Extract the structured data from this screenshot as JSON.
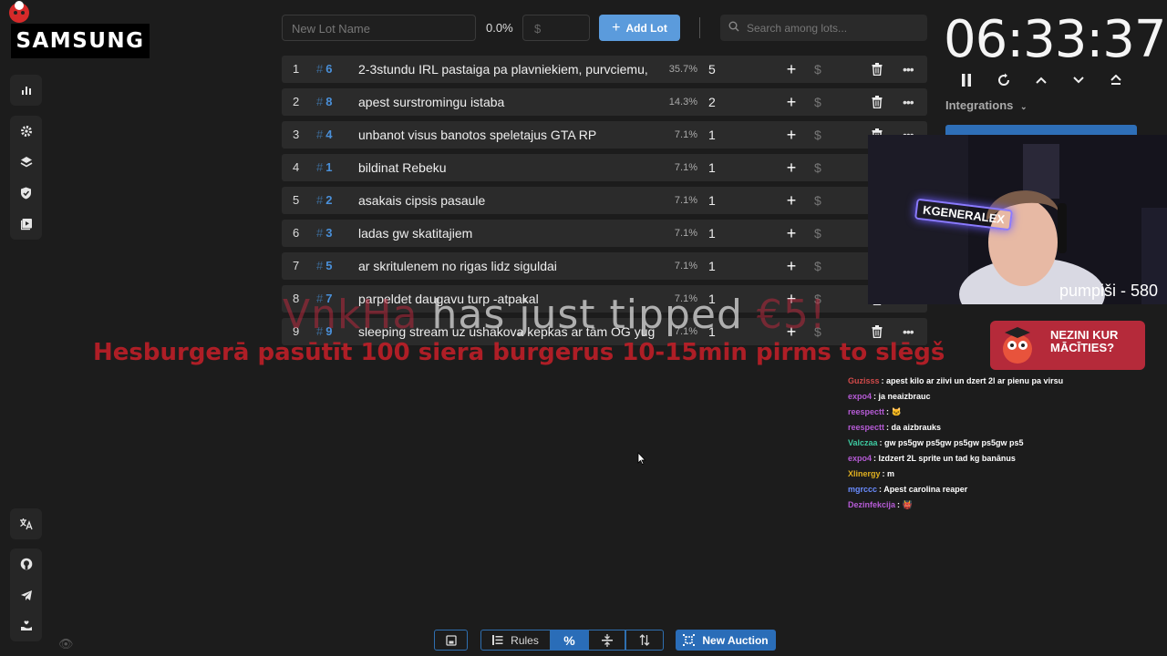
{
  "overlay_brand": "SAMSUNG",
  "topbar": {
    "lot_name_placeholder": "New Lot Name",
    "percent": "0.0%",
    "amount_placeholder": "$",
    "add_lot_label": "Add Lot",
    "search_placeholder": "Search among lots..."
  },
  "lots": [
    {
      "index": "1",
      "id": "6",
      "name": "2-3stundu IRL pastaiga pa plavniekiem, purvciemu,",
      "percent": "35.7%",
      "amount": "5"
    },
    {
      "index": "2",
      "id": "8",
      "name": "apest surstromingu istaba",
      "percent": "14.3%",
      "amount": "2"
    },
    {
      "index": "3",
      "id": "4",
      "name": "unbanot visus banotos speletajus GTA RP",
      "percent": "7.1%",
      "amount": "1"
    },
    {
      "index": "4",
      "id": "1",
      "name": "bildinat Rebeku",
      "percent": "7.1%",
      "amount": "1"
    },
    {
      "index": "5",
      "id": "2",
      "name": "asakais cipsis pasaule",
      "percent": "7.1%",
      "amount": "1"
    },
    {
      "index": "6",
      "id": "3",
      "name": "ladas gw skatitajiem",
      "percent": "7.1%",
      "amount": "1"
    },
    {
      "index": "7",
      "id": "5",
      "name": "ar skritulenem no rigas lidz siguldai",
      "percent": "7.1%",
      "amount": "1"
    },
    {
      "index": "8",
      "id": "7",
      "name": "parpeldet daugavu turp -atpakal",
      "percent": "7.1%",
      "amount": "1"
    },
    {
      "index": "9",
      "id": "9",
      "name": "sleeping stream uz ushakova kepkas ar tām OG yug",
      "percent": "7.1%",
      "amount": "1"
    }
  ],
  "timer": {
    "value": "06:33:37",
    "integrations_label": "Integrations"
  },
  "webcam": {
    "neon_sign": "KGENERALEX",
    "counter_text": "pumpiši - 580"
  },
  "tip_alert": {
    "user": "VnkHa",
    "text": "has just tipped",
    "amount": "€5!",
    "message": "Hesburgerā pasūtīt 100 siera burgerus 10-15min pirms to slēgš"
  },
  "ad": {
    "text_line1": "NEZINI KUR",
    "text_line2": "MĀCĪTIES?"
  },
  "chat": [
    {
      "user": "Guzisss",
      "text": ": apest kilo ar ziivi un dzert 2l ar pienu pa virsu",
      "color": "#d14a4a"
    },
    {
      "user": "expo4",
      "text": ": ja neaizbrauc",
      "color": "#b65bd6"
    },
    {
      "user": "reespectt",
      "text": ": 🐱",
      "color": "#b65bd6"
    },
    {
      "user": "reespectt",
      "text": ": da aizbrauks",
      "color": "#b65bd6"
    },
    {
      "user": "Valczaa",
      "text": ": gw ps5gw ps5gw ps5gw ps5gw ps5",
      "color": "#3dc9a0"
    },
    {
      "user": "expo4",
      "text": ": Izdzert 2L sprite un tad kg banānus",
      "color": "#b65bd6"
    },
    {
      "user": "Xlinergy",
      "text": ": m",
      "color": "#e0b020"
    },
    {
      "user": "mgrccc",
      "text": ": Apest carolina reaper",
      "color": "#6a8cff"
    },
    {
      "user": "Dezinfekcija",
      "text": ": 👹",
      "color": "#b65bd6"
    }
  ],
  "bottombar": {
    "rules_label": "Rules",
    "new_auction_label": "New Auction"
  }
}
